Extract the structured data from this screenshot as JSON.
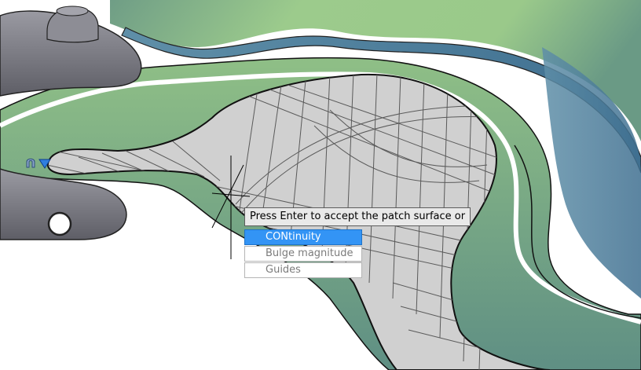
{
  "prompt": {
    "text": "Press Enter to accept the patch surface or"
  },
  "options": [
    {
      "label": "CONtinuity",
      "selected": true
    },
    {
      "label": "Bulge magnitude",
      "selected": false
    },
    {
      "label": "Guides",
      "selected": false
    }
  ],
  "icons": [
    "grip-magnet-icon",
    "grip-arrow-icon",
    "crosshair-cursor-icon"
  ],
  "colors": {
    "surface_green": "#9fc98a",
    "surface_dark": "#5c8a82",
    "patch_gray": "#d0d0d0",
    "solid_gray": "#7e7e86",
    "highlight": "#3394f5"
  }
}
